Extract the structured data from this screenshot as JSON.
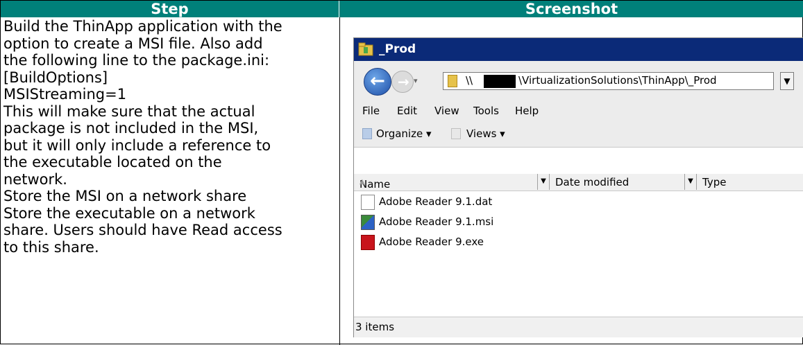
{
  "table": {
    "header_step": "Step",
    "header_screenshot": "Screenshot",
    "step_lines": [
      "Build the ThinApp application with the",
      "option to create a MSI file. Also add",
      "the following line to the package.ini:",
      "[BuildOptions]",
      "MSIStreaming=1",
      "This will make sure that the actual",
      "package is not included in the MSI,",
      "but it will only include a reference to",
      "the executable located on the",
      "network.",
      "Store the MSI on a network share",
      "Store the executable on a network",
      "share. Users should have Read access",
      "to this share."
    ]
  },
  "explorer": {
    "title": "_Prod",
    "address_prefix": "\\\\",
    "address_suffix": "\\VirtualizationSolutions\\ThinApp\\_Prod",
    "menu": [
      "File",
      "Edit",
      "View",
      "Tools",
      "Help"
    ],
    "toolbar": {
      "organize": "Organize ▾",
      "views": "Views ▾"
    },
    "columns": [
      "Name",
      "Date modified",
      "Type"
    ],
    "files": [
      {
        "name": "Adobe Reader 9.1.dat",
        "icon": "dat-file-icon"
      },
      {
        "name": "Adobe Reader 9.1.msi",
        "icon": "msi-file-icon"
      },
      {
        "name": "Adobe Reader 9.exe",
        "icon": "pdf-exe-icon"
      }
    ],
    "status": "3 items"
  }
}
